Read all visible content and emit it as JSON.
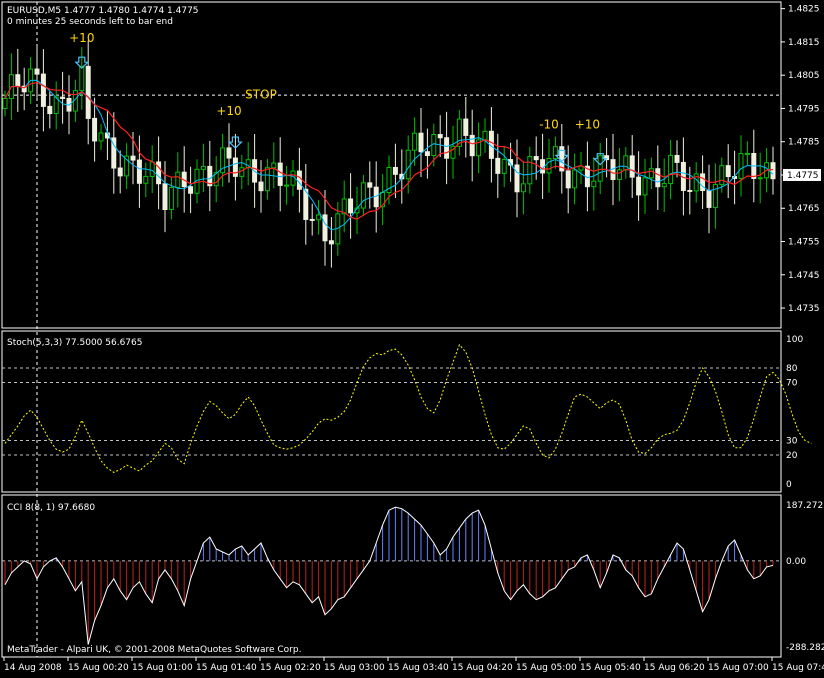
{
  "header": {
    "symbol_line": "EURUSD,M5  1.4777 1.4780 1.4774 1.4775",
    "timer_line": "0 minutes 25 seconds left to bar end"
  },
  "footer": {
    "copyright": "MetaTrader - Alpari UK, © 2001-2008 MetaQuotes Software Corp."
  },
  "colors": {
    "background": "#000000",
    "frame": "#ffffff",
    "candle_up": "#00c000",
    "candle_down": "#f0f0e0",
    "ma_fast": "#00bfff",
    "ma_slow": "#ff2020",
    "stoch": "#ffff00",
    "cci_line": "#ffffff",
    "cci_pos": "#6a7fff",
    "cci_neg": "#c02020",
    "annotation": "#ffd700",
    "arrow": "#4fc3f7"
  },
  "chart_data": [
    {
      "type": "candlestick",
      "title": "EURUSD,M5",
      "x_tick_labels": [
        "14 Aug 2008",
        "15 Aug 00:20",
        "15 Aug 01:00",
        "15 Aug 01:40",
        "15 Aug 02:20",
        "15 Aug 03:00",
        "15 Aug 03:40",
        "15 Aug 04:20",
        "15 Aug 05:00",
        "15 Aug 05:40",
        "15 Aug 06:20",
        "15 Aug 07:00",
        "15 Aug 07:40"
      ],
      "y_tick_labels": [
        "1.4825",
        "1.4805",
        "1.4785",
        "1.4765",
        "1.4745",
        "1.4815",
        "1.4795",
        "1.4775",
        "1.4755",
        "1.4735"
      ],
      "ylim": [
        1.4729,
        1.4827
      ],
      "current_price_label": "1.4775",
      "bar_count": 121,
      "key_closes": [
        {
          "bar": 0,
          "price": 1.4798
        },
        {
          "bar": 4,
          "price": 1.4803
        },
        {
          "bar": 8,
          "price": 1.4797
        },
        {
          "bar": 12,
          "price": 1.4801
        },
        {
          "bar": 13,
          "price": 1.479
        },
        {
          "bar": 16,
          "price": 1.4783
        },
        {
          "bar": 20,
          "price": 1.4778
        },
        {
          "bar": 25,
          "price": 1.4768
        },
        {
          "bar": 28,
          "price": 1.4776
        },
        {
          "bar": 32,
          "price": 1.4774
        },
        {
          "bar": 36,
          "price": 1.4779
        },
        {
          "bar": 40,
          "price": 1.4776
        },
        {
          "bar": 44,
          "price": 1.4772
        },
        {
          "bar": 47,
          "price": 1.4767
        },
        {
          "bar": 50,
          "price": 1.4758
        },
        {
          "bar": 53,
          "price": 1.4762
        },
        {
          "bar": 56,
          "price": 1.4768
        },
        {
          "bar": 60,
          "price": 1.4775
        },
        {
          "bar": 64,
          "price": 1.4781
        },
        {
          "bar": 68,
          "price": 1.4785
        },
        {
          "bar": 71,
          "price": 1.4789
        },
        {
          "bar": 73,
          "price": 1.4784
        },
        {
          "bar": 76,
          "price": 1.478
        },
        {
          "bar": 80,
          "price": 1.4776
        },
        {
          "bar": 84,
          "price": 1.4778
        },
        {
          "bar": 88,
          "price": 1.4776
        },
        {
          "bar": 92,
          "price": 1.4777
        },
        {
          "bar": 96,
          "price": 1.4775
        },
        {
          "bar": 100,
          "price": 1.4775
        },
        {
          "bar": 104,
          "price": 1.4776
        },
        {
          "bar": 107,
          "price": 1.477
        },
        {
          "bar": 110,
          "price": 1.4772
        },
        {
          "bar": 113,
          "price": 1.4777
        },
        {
          "bar": 116,
          "price": 1.4776
        },
        {
          "bar": 120,
          "price": 1.4775
        }
      ],
      "series": [
        {
          "indicator": "moving_average_fast",
          "color": "#00bfff"
        },
        {
          "indicator": "moving_average_slow",
          "color": "#ff2020"
        }
      ],
      "annotations": [
        {
          "text": "+10",
          "bar": 12,
          "price": 1.4815
        },
        {
          "text": "STOP",
          "bar": 40,
          "price": 1.4798
        },
        {
          "text": "+10",
          "bar": 35,
          "price": 1.4793
        },
        {
          "text": "-10",
          "bar": 85,
          "price": 1.4789
        },
        {
          "text": "+10",
          "bar": 91,
          "price": 1.4789
        }
      ],
      "arrows": [
        {
          "bar": 12,
          "price": 1.4808
        },
        {
          "bar": 36,
          "price": 1.4784
        },
        {
          "bar": 87,
          "price": 1.478
        },
        {
          "bar": 93,
          "price": 1.4779
        }
      ]
    },
    {
      "type": "line",
      "title": "Stoch(5,3,3) 77.5000 56.6765",
      "y_tick_labels": [
        "100",
        "80",
        "70",
        "30",
        "20",
        "0"
      ],
      "levels": [
        80,
        70,
        30,
        20
      ],
      "ylim": [
        0,
        100
      ],
      "values": [
        28,
        34,
        40,
        47,
        51,
        46,
        38,
        30,
        24,
        22,
        24,
        33,
        44,
        35,
        25,
        16,
        11,
        8,
        10,
        13,
        11,
        9,
        13,
        16,
        22,
        28,
        25,
        17,
        14,
        28,
        40,
        50,
        57,
        54,
        49,
        45,
        48,
        55,
        60,
        54,
        44,
        35,
        27,
        25,
        24,
        25,
        27,
        31,
        36,
        42,
        45,
        44,
        46,
        50,
        58,
        70,
        81,
        87,
        90,
        89,
        92,
        93,
        89,
        82,
        72,
        60,
        52,
        49,
        58,
        72,
        84,
        96,
        91,
        80,
        64,
        48,
        34,
        25,
        24,
        28,
        34,
        40,
        38,
        28,
        20,
        18,
        24,
        35,
        48,
        60,
        62,
        60,
        56,
        52,
        56,
        58,
        55,
        44,
        30,
        22,
        21,
        25,
        31,
        34,
        35,
        37,
        44,
        56,
        70,
        80,
        74,
        64,
        50,
        34,
        25,
        25,
        32,
        45,
        60,
        74,
        77,
        72,
        62,
        48,
        36,
        30,
        28
      ]
    },
    {
      "type": "histogram+line",
      "title": "CCI 8(8, 1) 97.6680",
      "y_tick_labels": [
        "187.2727",
        "0.00",
        "-288.2828"
      ],
      "ylim": [
        -288.2828,
        187.2727
      ],
      "values": [
        -80,
        -40,
        -20,
        0,
        -10,
        -60,
        -20,
        0,
        10,
        -20,
        -60,
        -100,
        -70,
        -280,
        -200,
        -150,
        -90,
        -60,
        -100,
        -130,
        -90,
        -70,
        -110,
        -140,
        -60,
        -30,
        -60,
        -100,
        -150,
        -60,
        0,
        60,
        80,
        40,
        30,
        20,
        40,
        50,
        20,
        40,
        60,
        10,
        -30,
        -60,
        -90,
        -70,
        -80,
        -110,
        -140,
        -120,
        -180,
        -160,
        -130,
        -120,
        -90,
        -60,
        -30,
        0,
        60,
        120,
        170,
        180,
        175,
        160,
        140,
        120,
        90,
        60,
        20,
        40,
        80,
        110,
        140,
        160,
        170,
        120,
        40,
        -40,
        -100,
        -130,
        -100,
        -80,
        -110,
        -130,
        -120,
        -100,
        -90,
        -60,
        -30,
        -20,
        10,
        20,
        -30,
        -90,
        -40,
        20,
        10,
        -30,
        -50,
        -90,
        -120,
        -110,
        -60,
        -20,
        20,
        60,
        40,
        -30,
        -100,
        -170,
        -130,
        -60,
        0,
        50,
        70,
        20,
        -30,
        -60,
        -50,
        -20,
        -15
      ]
    }
  ]
}
